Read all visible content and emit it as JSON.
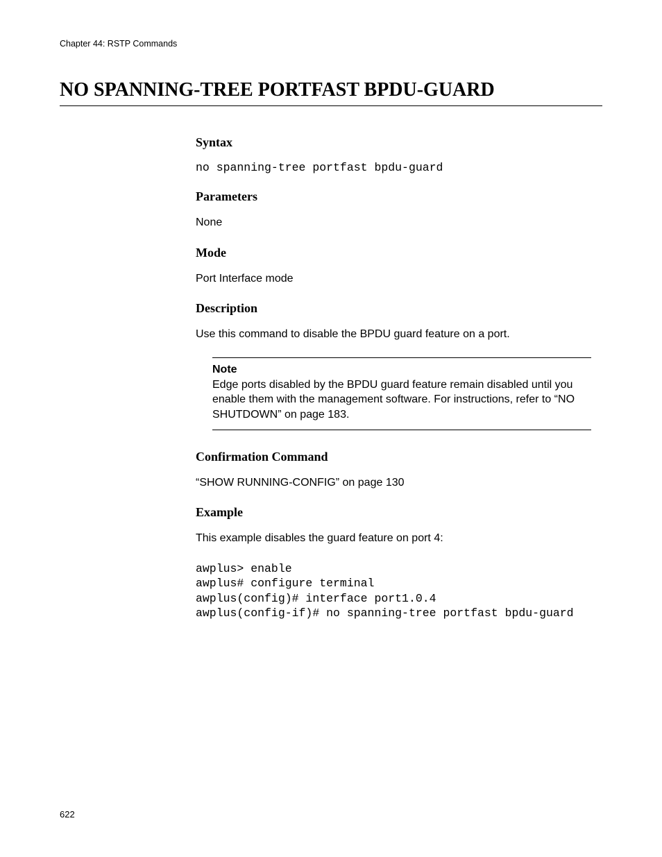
{
  "header": {
    "chapter": "Chapter 44: RSTP Commands"
  },
  "title": "NO SPANNING-TREE PORTFAST BPDU-GUARD",
  "sections": {
    "syntax": {
      "heading": "Syntax",
      "code": "no spanning-tree portfast bpdu-guard"
    },
    "parameters": {
      "heading": "Parameters",
      "text": "None"
    },
    "mode": {
      "heading": "Mode",
      "text": "Port Interface mode"
    },
    "description": {
      "heading": "Description",
      "text": "Use this command to disable the BPDU guard feature on a port.",
      "note": {
        "label": "Note",
        "text": "Edge ports disabled by the BPDU guard feature remain disabled until you enable them with the management software. For instructions, refer to “NO SHUTDOWN” on page 183."
      }
    },
    "confirmation": {
      "heading": "Confirmation Command",
      "text": "“SHOW RUNNING-CONFIG” on page 130"
    },
    "example": {
      "heading": "Example",
      "intro": "This example disables the guard feature on port 4:",
      "code": "awplus> enable\nawplus# configure terminal\nawplus(config)# interface port1.0.4\nawplus(config-if)# no spanning-tree portfast bpdu-guard"
    }
  },
  "page_number": "622"
}
